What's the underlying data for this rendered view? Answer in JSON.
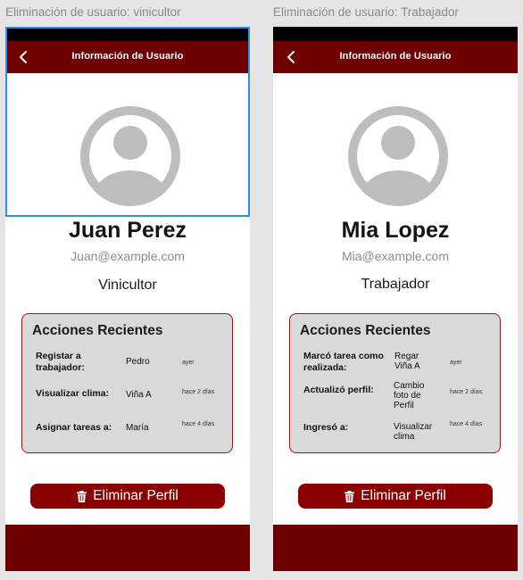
{
  "frames": [
    {
      "label": "Eliminación de usuario: vinicultor",
      "appbar_title": "Información de Usuario",
      "name": "Juan Perez",
      "email": "Juan@example.com",
      "role": "Vinicultor",
      "actions_title": "Acciones Recientes",
      "actions": [
        {
          "label": "Registar a trabajador:",
          "value": "Pedro",
          "time": "ayer"
        },
        {
          "label": "Visualizar clima:",
          "value": "Viña A",
          "time": "hace 2 días"
        },
        {
          "label": "Asignar tareas a:",
          "value": "María",
          "time": "hace 4 días"
        }
      ],
      "delete_label": "Eliminar Perfil"
    },
    {
      "label": "Eliminación de usuario: Trabajador",
      "appbar_title": "Información de Usuario",
      "name": "Mia Lopez",
      "email": "Mia@example.com",
      "role": "Trabajador",
      "actions_title": "Acciones Recientes",
      "actions": [
        {
          "label": "Marcó tarea como realizada:",
          "value": "Regar Viña A",
          "time": "ayer"
        },
        {
          "label": "Actualizó perfil:",
          "value": "Cambio foto de Perfil",
          "time": "hace 2 días"
        },
        {
          "label": "Ingresó a:",
          "value": "Visualizar clima",
          "time": "hace 4 días"
        }
      ],
      "delete_label": "Eliminar Perfil"
    }
  ],
  "colors": {
    "appbar": "#6e0000",
    "delete_button": "#8b0000",
    "selection": "#2a8ff0",
    "card": "#d9d9d9",
    "avatar": "#bdbdbd"
  },
  "icons": {
    "back": "chevron-left-icon",
    "avatar": "user-avatar-icon",
    "delete": "trash-icon"
  }
}
